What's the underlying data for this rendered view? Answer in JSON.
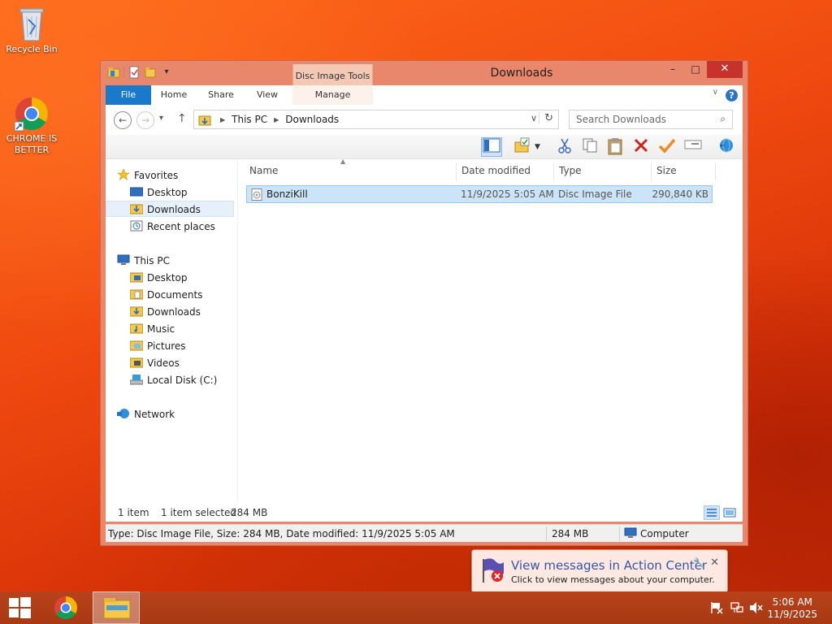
{
  "desktop": {
    "icons": [
      {
        "label": "Recycle Bin"
      },
      {
        "label": "CHROME IS BETTER"
      }
    ]
  },
  "window": {
    "title": "Downloads",
    "contextual_group": "Disc Image Tools",
    "minimize": "–",
    "maximize": "□",
    "close": "✕",
    "ribbon_tabs": [
      "File",
      "Home",
      "Share",
      "View",
      "Manage"
    ],
    "help": "?",
    "collapse": "∨"
  },
  "address": {
    "back": "←",
    "forward": "→",
    "history": "▾",
    "up": "↑",
    "crumbs": [
      "This PC",
      "Downloads"
    ],
    "dropdown": "∨",
    "refresh": "↻",
    "search_placeholder": "Search Downloads",
    "search_icon": "⌕"
  },
  "nav": {
    "favorites": "Favorites",
    "fav_items": [
      "Desktop",
      "Downloads",
      "Recent places"
    ],
    "this_pc": "This PC",
    "pc_items": [
      "Desktop",
      "Documents",
      "Downloads",
      "Music",
      "Pictures",
      "Videos",
      "Local Disk (C:)"
    ],
    "network": "Network"
  },
  "columns": [
    "Name",
    "Date modified",
    "Type",
    "Size"
  ],
  "files": [
    {
      "name": "BonziKill",
      "date": "11/9/2025 5:05 AM",
      "type": "Disc Image File",
      "size": "290,840 KB"
    }
  ],
  "status": {
    "count": "1 item",
    "selected": "1 item selected",
    "selected_size": "284 MB"
  },
  "infobar": {
    "details": "Type: Disc Image File, Size: 284 MB, Date modified: 11/9/2025 5:05 AM",
    "size": "284 MB",
    "location": "Computer"
  },
  "balloon": {
    "title": "View messages in Action Center",
    "text": "Click to view messages about your computer.",
    "close": "✕"
  },
  "taskbar": {
    "time": "5:06 AM",
    "date": "11/9/2025"
  },
  "colors": {
    "accent": "#1979ca",
    "close_red": "#c7322c",
    "selection": "#cce4f7",
    "taskbar": "#a83912"
  }
}
